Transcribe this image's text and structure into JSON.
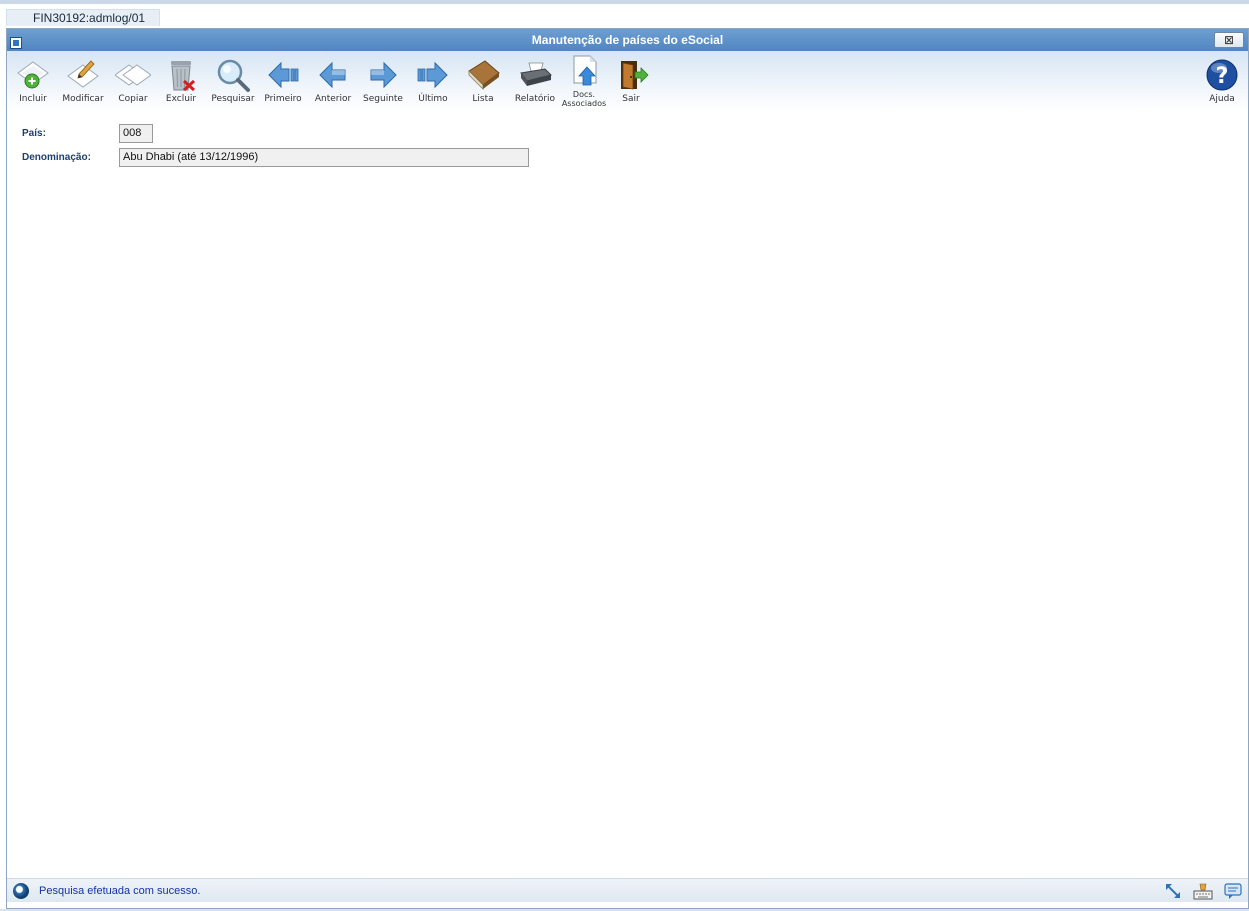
{
  "tab": {
    "label": "FIN30192:admlog/01"
  },
  "window": {
    "title": "Manutenção de países do eSocial",
    "close_label": "⊠"
  },
  "toolbar": {
    "buttons": [
      {
        "id": "incluir",
        "label": "Incluir",
        "icon": "add-diamond-icon"
      },
      {
        "id": "modificar",
        "label": "Modificar",
        "icon": "edit-pencil-icon"
      },
      {
        "id": "copiar",
        "label": "Copiar",
        "icon": "copy-diamonds-icon"
      },
      {
        "id": "excluir",
        "label": "Excluir",
        "icon": "trash-delete-icon"
      },
      {
        "id": "pesquisar",
        "label": "Pesquisar",
        "icon": "magnifier-icon"
      },
      {
        "id": "primeiro",
        "label": "Primeiro",
        "icon": "arrow-first-icon"
      },
      {
        "id": "anterior",
        "label": "Anterior",
        "icon": "arrow-left-icon"
      },
      {
        "id": "seguinte",
        "label": "Seguinte",
        "icon": "arrow-right-icon"
      },
      {
        "id": "ultimo",
        "label": "Último",
        "icon": "arrow-last-icon"
      },
      {
        "id": "lista",
        "label": "Lista",
        "icon": "book-icon"
      },
      {
        "id": "relatorio",
        "label": "Relatório",
        "icon": "printer-icon"
      },
      {
        "id": "docs",
        "label": "Docs. Associados",
        "icon": "document-upload-icon"
      },
      {
        "id": "sair",
        "label": "Sair",
        "icon": "exit-door-icon"
      }
    ],
    "help": {
      "label": "Ajuda",
      "icon": "help-question-icon"
    }
  },
  "form": {
    "pais": {
      "label": "País:",
      "value": "008"
    },
    "denominacao": {
      "label": "Denominação:",
      "value": "Abu Dhabi (até 13/12/1996)"
    }
  },
  "status": {
    "message": "Pesquisa efetuada com sucesso.",
    "icons": [
      "resize-arrow-icon",
      "keyboard-icon",
      "chat-icon"
    ]
  },
  "colors": {
    "titlebar": "#5a8ec8",
    "label_blue": "#1f3f6b",
    "status_text": "#1532a0",
    "arrow_blue": "#4d8fd1"
  }
}
